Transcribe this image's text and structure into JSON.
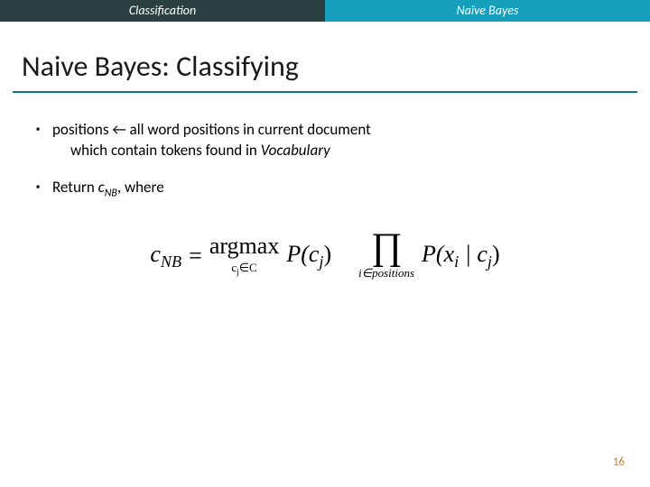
{
  "tabs": {
    "left": "Classification",
    "right": "Naïve Bayes"
  },
  "title": "Naive Bayes: Classifying",
  "bullets": {
    "b1_line1_a": "positions ",
    "b1_line1_b": " all word positions in current document",
    "b1_line2_a": "which contain tokens found in ",
    "b1_line2_b": "Vocabulary",
    "b2_a": "Return ",
    "b2_var": "c",
    "b2_sub": "NB",
    "b2_b": ", where"
  },
  "formula": {
    "lhs_var": "c",
    "lhs_sub": "NB",
    "eq": "=",
    "argmax": "argmax",
    "argmax_under_a": "c",
    "argmax_under_b": "j",
    "argmax_under_c": "∈C",
    "p1_a": "P(c",
    "p1_b": "j",
    "p1_c": ")",
    "prod": "∏",
    "prod_under": "i∈positions",
    "p2_a": "P(x",
    "p2_b": "i",
    "p2_c": " | c",
    "p2_d": "j",
    "p2_e": ")"
  },
  "page_number": "16",
  "arrow": "←"
}
